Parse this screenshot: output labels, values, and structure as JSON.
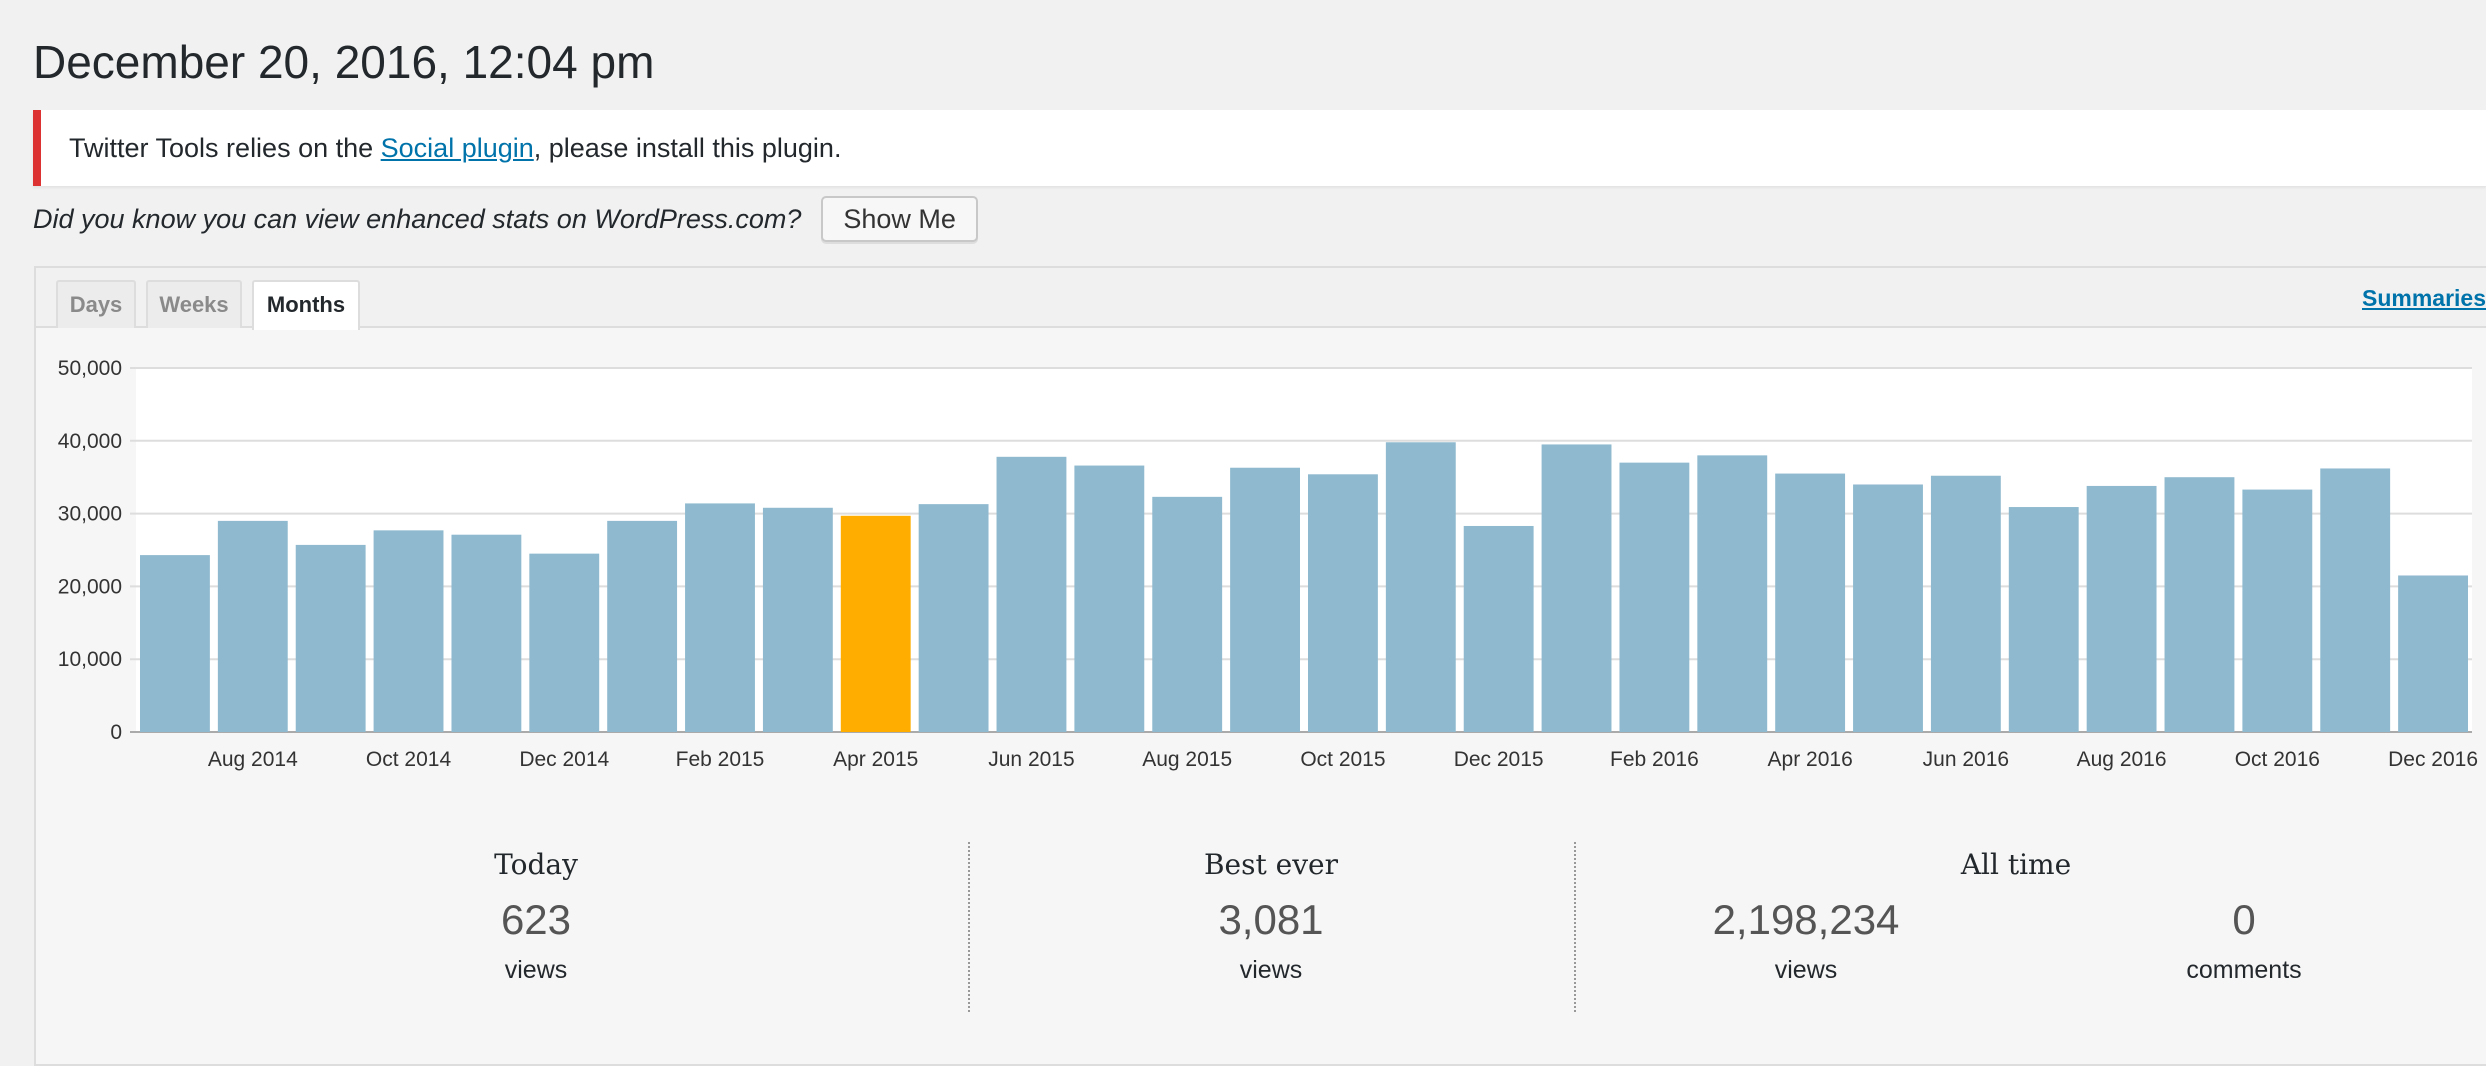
{
  "page": {
    "title": "December 20, 2016, 12:04 pm"
  },
  "notice": {
    "text_before": "Twitter Tools relies on the ",
    "link_text": "Social plugin",
    "text_after": ", please install this plugin.",
    "border_color": "#dc3232"
  },
  "promo": {
    "text": "Did you know you can view enhanced stats on WordPress.com?",
    "button_label": "Show Me"
  },
  "tabs": {
    "items": [
      {
        "label": "Days",
        "active": false
      },
      {
        "label": "Weeks",
        "active": false
      },
      {
        "label": "Months",
        "active": true
      }
    ],
    "summaries_label": "Summaries"
  },
  "chart_data": {
    "type": "bar",
    "categories": [
      "Jul 2014",
      "Aug 2014",
      "Sep 2014",
      "Oct 2014",
      "Nov 2014",
      "Dec 2014",
      "Jan 2015",
      "Feb 2015",
      "Mar 2015",
      "Apr 2015",
      "May 2015",
      "Jun 2015",
      "Jul 2015",
      "Aug 2015",
      "Sep 2015",
      "Oct 2015",
      "Nov 2015",
      "Dec 2015",
      "Jan 2016",
      "Feb 2016",
      "Mar 2016",
      "Apr 2016",
      "May 2016",
      "Jun 2016",
      "Jul 2016",
      "Aug 2016",
      "Sep 2016",
      "Oct 2016",
      "Nov 2016",
      "Dec 2016"
    ],
    "x_tick_labels": [
      "Aug 2014",
      "Oct 2014",
      "Dec 2014",
      "Feb 2015",
      "Apr 2015",
      "Jun 2015",
      "Aug 2015",
      "Oct 2015",
      "Dec 2015",
      "Feb 2016",
      "Apr 2016",
      "Jun 2016",
      "Aug 2016",
      "Oct 2016",
      "Dec 2016"
    ],
    "values": [
      24300,
      29000,
      25700,
      27700,
      27100,
      24500,
      29000,
      31400,
      30800,
      29700,
      31300,
      37800,
      36600,
      32300,
      36300,
      35400,
      39800,
      28300,
      39500,
      37000,
      38000,
      35500,
      34000,
      35200,
      30900,
      33800,
      35000,
      33300,
      36200,
      21500
    ],
    "highlight_index": 9,
    "bar_color": "#8fb9cf",
    "highlight_color": "#ffae00",
    "y_ticks": [
      "0",
      "10,000",
      "20,000",
      "30,000",
      "40,000",
      "50,000"
    ],
    "ylim": [
      0,
      50000
    ],
    "grid": true
  },
  "summary": {
    "today": {
      "title": "Today",
      "value": "623",
      "unit": "views"
    },
    "best_ever": {
      "title": "Best ever",
      "value": "3,081",
      "unit": "views"
    },
    "all_time": {
      "title": "All time",
      "views_value": "2,198,234",
      "views_unit": "views",
      "comments_value": "0",
      "comments_unit": "comments"
    }
  }
}
